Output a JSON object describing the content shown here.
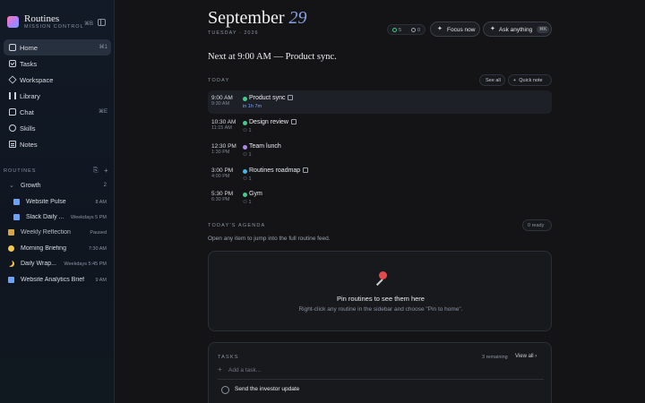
{
  "brand": {
    "title": "Routines",
    "subtitle": "MISSION CONTROL",
    "shortcut": "⌘B"
  },
  "nav": [
    {
      "label": "Home",
      "icon": "home-icon",
      "kbd": "⌘1",
      "active": true
    },
    {
      "label": "Tasks",
      "icon": "tasks-icon",
      "kbd": ""
    },
    {
      "label": "Workspace",
      "icon": "workspace-icon",
      "kbd": ""
    },
    {
      "label": "Library",
      "icon": "library-icon",
      "kbd": ""
    },
    {
      "label": "Chat",
      "icon": "chat-icon",
      "kbd": "⌘E"
    },
    {
      "label": "Skills",
      "icon": "skills-icon",
      "kbd": ""
    },
    {
      "label": "Notes",
      "icon": "notes-icon",
      "kbd": ""
    }
  ],
  "routines": {
    "heading": "ROUTINES",
    "group": {
      "label": "Growth",
      "count": "2"
    },
    "items": [
      {
        "label": "Website Pulse",
        "schedule": "8 AM",
        "color": "#6aa2ff"
      },
      {
        "label": "Slack Daily ...",
        "schedule": "Weekdays 5 PM",
        "color": "#6aa2ff"
      },
      {
        "label": "Weekly Reflection",
        "schedule": "Paused",
        "color": "#d9a441"
      },
      {
        "label": "Morning Briefing",
        "schedule": "7:30 AM",
        "color": "#f2c94c"
      },
      {
        "label": "Daily Wrap...",
        "schedule": "Weekdays 5:45 PM",
        "color": "#f2c94c"
      },
      {
        "label": "Website Analytics Brief",
        "schedule": "9 AM",
        "color": "#6aa2ff"
      }
    ]
  },
  "header": {
    "month": "September",
    "day": "29",
    "subtitle": "TUESDAY · 2026",
    "stat_done": "5",
    "stat_pending": "0",
    "focus_label": "Focus now",
    "ask_label": "Ask anything",
    "ask_kbd": "⌘K"
  },
  "next_line": "Next at 9:00 AM — Product sync.",
  "today": {
    "label": "TODAY",
    "see_all": "See all",
    "quick_note": "Quick note",
    "events": [
      {
        "start": "9:00 AM",
        "end": "9:30 AM",
        "title": "Product sync",
        "meta": "in 1h 7m",
        "color": "#3ccf8e",
        "calendar": true
      },
      {
        "start": "10:30 AM",
        "end": "11:15 AM",
        "title": "Design review",
        "meta": "1",
        "color": "#3ccf8e",
        "calendar": true
      },
      {
        "start": "12:30 PM",
        "end": "1:30 PM",
        "title": "Team lunch",
        "meta": "1",
        "color": "#a98bf0",
        "calendar": false
      },
      {
        "start": "3:00 PM",
        "end": "4:00 PM",
        "title": "Routines roadmap",
        "meta": "1",
        "color": "#3bb8e8",
        "calendar": true
      },
      {
        "start": "5:30 PM",
        "end": "6:30 PM",
        "title": "Gym",
        "meta": "1",
        "color": "#3ccf8e",
        "calendar": false
      }
    ]
  },
  "agenda": {
    "label": "TODAY'S AGENDA",
    "ready": "0 ready",
    "desc": "Open any item to jump into the full routine feed.",
    "pin_title": "Pin routines to see them here",
    "pin_sub": "Right-click any routine in the sidebar and choose \"Pin to home\"."
  },
  "tasks": {
    "label": "TASKS",
    "remaining": "3 remaining",
    "view_all": "View all",
    "add_placeholder": "Add a task...",
    "items": [
      {
        "label": "Send the investor update"
      }
    ]
  }
}
